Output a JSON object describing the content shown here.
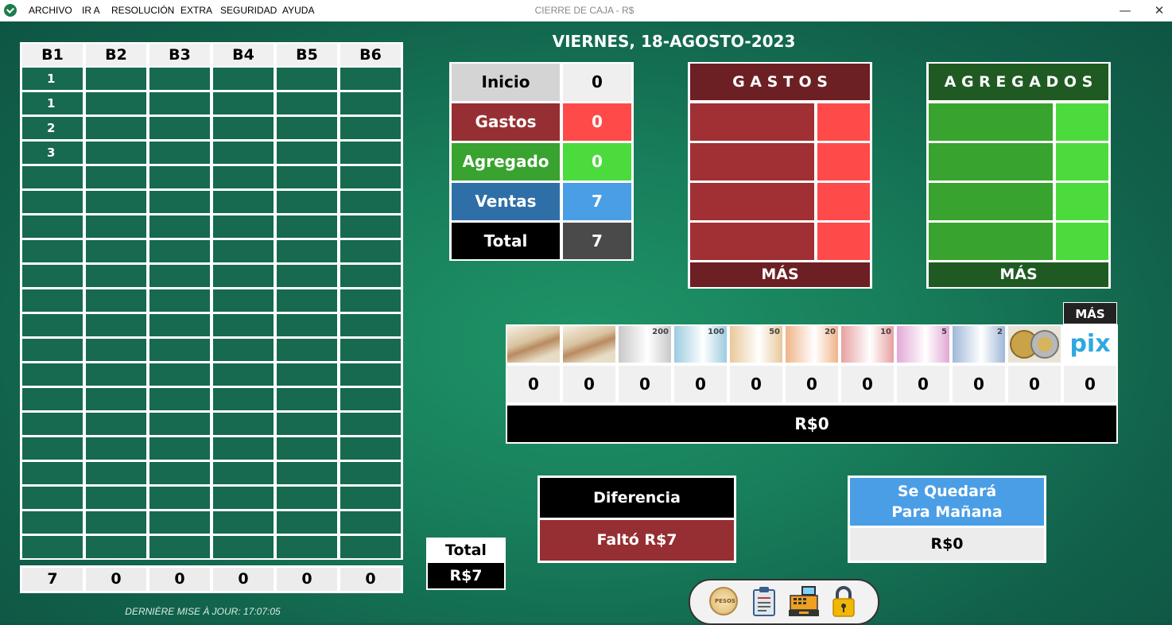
{
  "menu": {
    "items": [
      "ARCHIVO",
      "IR A",
      "RESOLUCIÓN",
      "EXTRA",
      "SEGURIDAD",
      "AYUDA"
    ],
    "window_title": "CIERRE DE CAJA - R$"
  },
  "window_controls": {
    "minimize": "—",
    "close": "✕"
  },
  "date": "VIERNES, 18-AGOSTO-2023",
  "b_grid": {
    "headers": [
      "B1",
      "B2",
      "B3",
      "B4",
      "B5",
      "B6"
    ],
    "b1_values": [
      "1",
      "1",
      "2",
      "3"
    ],
    "totals": [
      "7",
      "0",
      "0",
      "0",
      "0",
      "0"
    ]
  },
  "last_update": "DERNIÈRE MISE À JOUR: 17:07:05",
  "summary": {
    "rows": [
      {
        "label": "Inicio",
        "value": "0"
      },
      {
        "label": "Gastos",
        "value": "0"
      },
      {
        "label": "Agregado",
        "value": "0"
      },
      {
        "label": "Ventas",
        "value": "7"
      },
      {
        "label": "Total",
        "value": "7"
      }
    ]
  },
  "gastos": {
    "title": "G A S T O S",
    "more": "MÁS"
  },
  "agregados": {
    "title": "A G R E G A D O S",
    "more": "MÁS"
  },
  "money": {
    "more": "MÁS",
    "pix_label": "pix",
    "denominations": [
      "200",
      "100",
      "50",
      "20",
      "10",
      "5",
      "2"
    ],
    "counts": [
      "0",
      "0",
      "0",
      "0",
      "0",
      "0",
      "0",
      "0",
      "0",
      "0",
      "0"
    ],
    "total": "R$0"
  },
  "total_box": {
    "label": "Total",
    "value": "R$7"
  },
  "diferencia": {
    "label": "Diferencia",
    "value": "Faltó R$7"
  },
  "manana": {
    "label_line1": "Se Quedará",
    "label_line2": "Para Mañana",
    "value": "R$0"
  },
  "toolbar": {
    "coin_label": "PESOS"
  },
  "colors": {
    "gastos_dark": "#962f33",
    "gastos_light": "#ff4a4a",
    "agregado_dark": "#38a32e",
    "agregado_light": "#4cdb3c",
    "ventas_dark": "#2f6fa8",
    "ventas_light": "#4a9ee6"
  }
}
